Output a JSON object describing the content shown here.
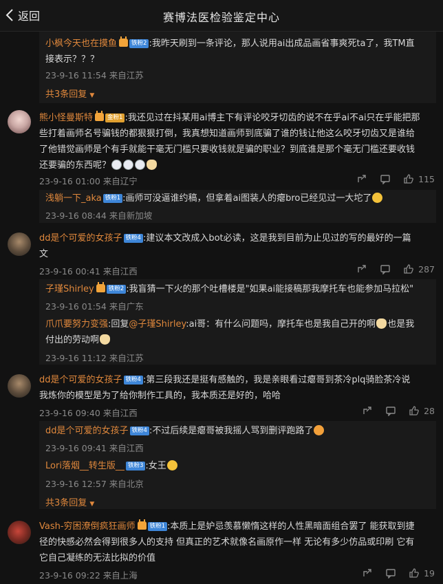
{
  "header": {
    "back_label": "返回",
    "title": "赛博法医检验鉴定中心"
  },
  "thread0": {
    "reply": {
      "user": "小枫今天也在摸鱼",
      "badge": "铁粉2",
      "text_line1": ":我昨天刷到一条评论，那人说用ai出成品画省事爽死ta了，我TM直",
      "text_line2": "接表示？？？",
      "time": "23-9-16 11:54 来自江苏"
    },
    "more": "共3条回复"
  },
  "comment1": {
    "user": "熊小怪曼斯特",
    "badge": "金粉1",
    "line1": ":我还见过在抖某用ai博主下有评论咬牙切齿的说不在乎ai不ai只在乎能把那",
    "line2": "些打着画师名号骗钱的都狠狠打倒，我真想知道画师到底骗了谁的钱让他这么咬牙切齿又是谁给",
    "line3": "了他错觉画师是个有手就能干毫无门槛只要收钱就是骗的职业？到底谁是那个毫无门槛还要收钱",
    "line4": "还要骗的东西呢？",
    "time": "23-9-16 01:00 来自辽宁",
    "likes": "115",
    "replies": [
      {
        "user": "浅躺一下_aka",
        "badge": "铁粉1",
        "text": ":画师可没逼谁约稿，但拿着ai图装人的瘪bro已经见过一大坨了",
        "time": "23-9-16 08:44 来自新加坡"
      }
    ]
  },
  "comment2": {
    "user": "dd是个可爱的女孩子",
    "badge": "铁粉4",
    "line1": ":建议本文改成入bot必读，这是我到目前为止见过的写的最好的一篇",
    "line2": "文",
    "time": "23-9-16 00:41 来自江西",
    "likes": "287",
    "replies": [
      {
        "user": "子瑾Shirley",
        "badge": "铁粉2",
        "text": ":我盲猜一下火的那个吐槽楼是\"如果ai能接稿那我摩托车也能参加马拉松\"",
        "time": "23-9-16 01:54 来自广东"
      },
      {
        "user": "爪爪要努力变强",
        "prefix": ":回复",
        "mention": "@子瑾Shirley",
        "text_line1": ":ai哥：有什么问题吗，摩托车也是我自己开的啊",
        "text_mid": "也是我",
        "text_line2": "付出的劳动啊",
        "time": "23-9-16 11:12 来自江苏"
      }
    ]
  },
  "comment3": {
    "user": "dd是个可爱的女孩子",
    "badge": "铁粉4",
    "line1": ":第三段我还是挺有感触的，我是亲眼看过瘪哥到茶冷plq骑脸茶冷说",
    "line2": "我炼你的模型是为了给你制作工具的，我本质还是好的，哈哈",
    "time": "23-9-16 09:40 来自江西",
    "likes": "28",
    "replies": [
      {
        "user": "dd是个可爱的女孩子",
        "badge": "铁粉4",
        "text": ":不过后续是瘪哥被我摇人骂到删评跑路了",
        "time": "23-9-16 09:41 来自江西"
      },
      {
        "user": "Lori落烟__转生版__",
        "badge": "铁粉3",
        "text": ":女王",
        "time": "23-9-16 12:57 来自北京"
      }
    ],
    "more": "共3条回复"
  },
  "comment4": {
    "user": "Vash-穷困潦倒疯狂画师",
    "badge": "铁粉1",
    "line1": ":本质上是妒忌羡慕懒惰这样的人性黑暗面组合罢了 能获取到捷",
    "line2": "径的快感必然会得到很多人的支持 但真正的艺术就像名画原作一样 无论有多少仿品或印刷 它有",
    "line3": "它自己凝练的无法比拟的价值",
    "time": "23-9-16 09:22 来自上海",
    "likes": "19"
  },
  "colors": {
    "background": "#121212",
    "accent": "#e0883c",
    "badge": "#3e86d8"
  }
}
